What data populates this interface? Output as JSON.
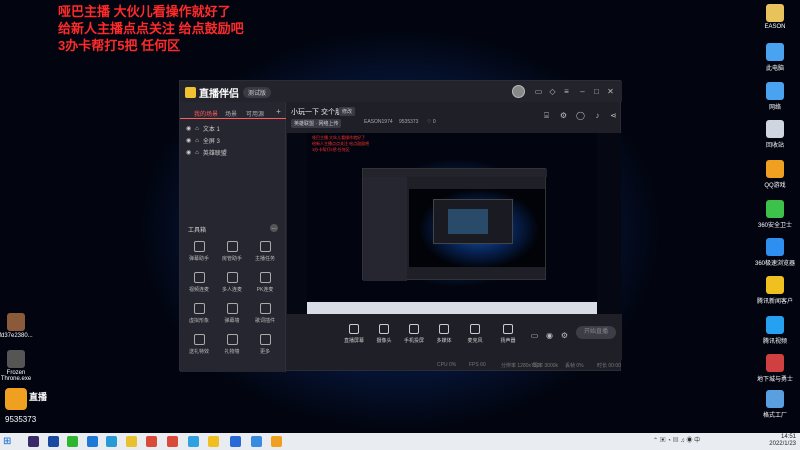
{
  "overlay": {
    "line1": "哑巴主播 大伙儿看操作就好了",
    "line2": "给新人主播点点关注 给点鼓励吧",
    "line3": "3办卡帮打5把 任何区"
  },
  "desktop_icons_right": [
    {
      "label": "EASON",
      "icon": "folder-icon",
      "color": "#e8c25a"
    },
    {
      "label": "此电脑",
      "icon": "computer-icon",
      "color": "#4aa3f0"
    },
    {
      "label": "网络",
      "icon": "network-icon",
      "color": "#4aa3f0"
    },
    {
      "label": "回收站",
      "icon": "recycle-bin-icon",
      "color": "#cfd6e0"
    },
    {
      "label": "QQ游戏",
      "icon": "qq-game-icon",
      "color": "#f0a020"
    },
    {
      "label": "360安全卫士",
      "icon": "shield-icon",
      "color": "#3cc24a"
    },
    {
      "label": "360极速浏览器",
      "icon": "browser-icon",
      "color": "#2f8ff0"
    },
    {
      "label": "腾讯新闻客户",
      "icon": "news-icon",
      "color": "#f0c020"
    },
    {
      "label": "腾讯视频",
      "icon": "video-icon",
      "color": "#26a0f0"
    },
    {
      "label": "地下城与勇士",
      "icon": "game-icon",
      "color": "#d04040"
    },
    {
      "label": "格式工厂",
      "icon": "factory-icon",
      "color": "#5aa0e0"
    }
  ],
  "desktop_icons_left": [
    {
      "label": "fd37e2380...",
      "icon": "file-icon",
      "color": "#8a5a3a"
    },
    {
      "label": "Frozen Throne.exe",
      "icon": "warcraft-icon",
      "color": "#555"
    }
  ],
  "watermark": {
    "id": "9535373"
  },
  "app": {
    "logo": "直播伴侣",
    "badge": "测试版",
    "tabs": [
      "我的场景",
      "场景",
      "可用源"
    ],
    "scenes": [
      "文本 1",
      "全屏 3",
      "英雄联盟"
    ],
    "tools_title": "工具箱",
    "tools": [
      "弹幕助手",
      "房管助手",
      "主播任务",
      "视频连麦",
      "多人连麦",
      "PK连麦",
      "虚拟形象",
      "弹幕墙",
      "歌词插件",
      "送礼特效",
      "礼物墙",
      "更多"
    ],
    "header_title": "小玩一下 交个朋友",
    "header_tag": "修改",
    "header_info": [
      "英雄联盟 · 网络上传",
      "EASON1974",
      "9535373",
      "0"
    ],
    "bottom_buttons": [
      "直播屏幕",
      "摄像头",
      "手机投屏",
      "多媒体",
      "麦克风",
      "扬声器"
    ],
    "go_live": "开始直播",
    "status": [
      "CPU 0%",
      "FPS 60",
      "分辨率 1280x720",
      "码率 3000k",
      "丢帧 0%",
      "时长 00:00"
    ]
  },
  "taskbar": {
    "time": "14:51",
    "date": "2022/1/23"
  }
}
